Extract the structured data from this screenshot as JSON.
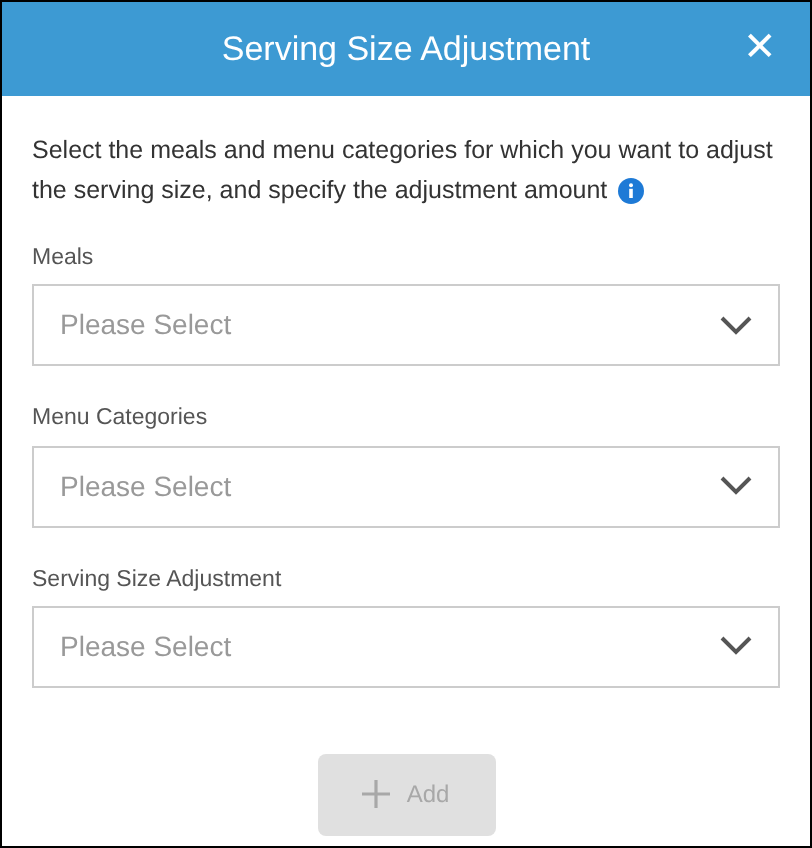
{
  "window": {
    "title": "Serving Size Adjustment",
    "close": "✕"
  },
  "description": "Select the meals and menu categories for which you want to adjust the serving size, and specify the adjustment amount",
  "fields": [
    {
      "label": "Meals",
      "placeholder": "Please Select"
    },
    {
      "label": "Menu Categories",
      "placeholder": "Please Select"
    },
    {
      "label": "Serving Size Adjustment",
      "placeholder": "Please Select"
    }
  ],
  "add_button": {
    "label": "Add",
    "disabled": true
  }
}
